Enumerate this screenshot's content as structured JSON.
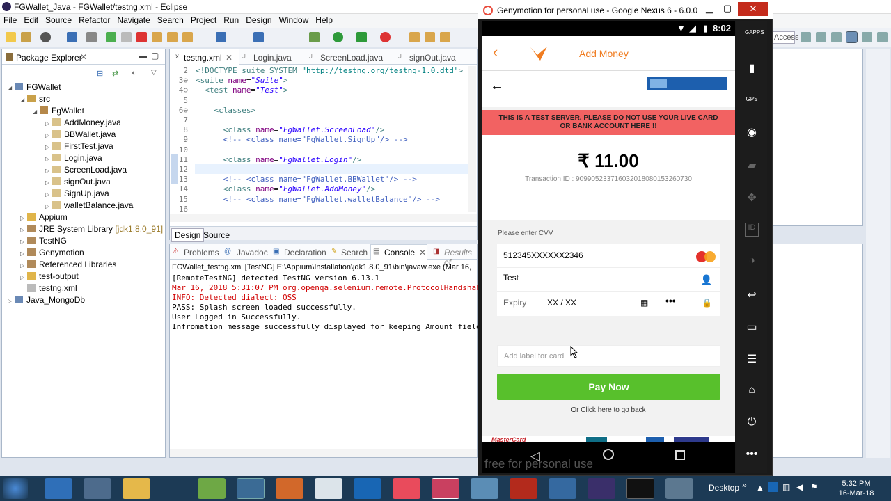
{
  "eclipse": {
    "title": "FGWallet_Java - FGWallet/testng.xml - Eclipse",
    "menu": [
      "File",
      "Edit",
      "Source",
      "Refactor",
      "Navigate",
      "Search",
      "Project",
      "Run",
      "Design",
      "Window",
      "Help"
    ],
    "quick_access": "Access",
    "package_explorer": {
      "tab": "Package Explorer",
      "items": [
        {
          "label": "FGWallet",
          "indent": 0,
          "icon": "project-icon",
          "arrow": "◢"
        },
        {
          "label": "src",
          "indent": 1,
          "icon": "source-folder-icon",
          "arrow": "◢"
        },
        {
          "label": "FgWallet",
          "indent": 2,
          "icon": "package-icon",
          "arrow": "◢"
        },
        {
          "label": "AddMoney.java",
          "indent": 3,
          "icon": "java-file-icon",
          "arrow": "▷"
        },
        {
          "label": "BBWallet.java",
          "indent": 3,
          "icon": "java-file-icon",
          "arrow": "▷"
        },
        {
          "label": "FirstTest.java",
          "indent": 3,
          "icon": "java-file-icon",
          "arrow": "▷"
        },
        {
          "label": "Login.java",
          "indent": 3,
          "icon": "java-file-icon",
          "arrow": "▷"
        },
        {
          "label": "ScreenLoad.java",
          "indent": 3,
          "icon": "java-file-icon",
          "arrow": "▷"
        },
        {
          "label": "signOut.java",
          "indent": 3,
          "icon": "java-file-icon",
          "arrow": "▷"
        },
        {
          "label": "SignUp.java",
          "indent": 3,
          "icon": "java-file-icon",
          "arrow": "▷"
        },
        {
          "label": "walletBalance.java",
          "indent": 3,
          "icon": "java-file-icon",
          "arrow": "▷"
        },
        {
          "label": "Appium",
          "indent": 1,
          "icon": "folder-icon",
          "arrow": "▷"
        },
        {
          "label": "JRE System Library",
          "suffix": "[jdk1.8.0_91]",
          "indent": 1,
          "icon": "library-icon",
          "arrow": "▷"
        },
        {
          "label": "TestNG",
          "indent": 1,
          "icon": "library-icon",
          "arrow": "▷"
        },
        {
          "label": "Genymotion",
          "indent": 1,
          "icon": "library-icon",
          "arrow": "▷"
        },
        {
          "label": "Referenced Libraries",
          "indent": 1,
          "icon": "library-icon",
          "arrow": "▷"
        },
        {
          "label": "test-output",
          "indent": 1,
          "icon": "folder-icon",
          "arrow": "▷"
        },
        {
          "label": "testng.xml",
          "indent": 1,
          "icon": "xml-file-icon",
          "arrow": ""
        },
        {
          "label": "Java_MongoDb",
          "indent": 0,
          "icon": "project-icon",
          "arrow": "▷"
        }
      ]
    },
    "editor": {
      "tabs": [
        "testng.xml",
        "Login.java",
        "ScreenLoad.java",
        "signOut.java"
      ],
      "lines": [
        {
          "n": "2",
          "html": "<span class=\"tag\">&lt;!DOCTYPE suite SYSTEM </span><span class=\"dt\">\"http://testng.org/testng-1.0.dtd\"</span><span class=\"tag\">&gt;</span>"
        },
        {
          "n": "3⊖",
          "html": "<span class=\"tag\">&lt;suite </span><span class=\"attr\">name</span>=<span class=\"str\">\"Suite\"</span><span class=\"tag\">&gt;</span>"
        },
        {
          "n": "4⊖",
          "html": "  <span class=\"tag\">&lt;test </span><span class=\"attr\">name</span>=<span class=\"str\">\"Test\"</span><span class=\"tag\">&gt;</span>"
        },
        {
          "n": "5",
          "html": ""
        },
        {
          "n": "6⊖",
          "html": "    <span class=\"tag\">&lt;classes&gt;</span>"
        },
        {
          "n": "7",
          "html": ""
        },
        {
          "n": "8",
          "html": "      <span class=\"tag\">&lt;class </span><span class=\"attr\">name</span>=<span class=\"str\">\"FgWallet.ScreenLoad\"</span><span class=\"tag\">/&gt;</span>"
        },
        {
          "n": "9",
          "html": "      <span class=\"cmt\">&lt;!-- &lt;class name=\"FgWallet.SignUp\"/&gt; --&gt;</span>"
        },
        {
          "n": "10",
          "html": ""
        },
        {
          "n": "11",
          "html": "      <span class=\"tag\">&lt;class </span><span class=\"attr\">name</span>=<span class=\"str\">\"FgWallet.Login\"</span><span class=\"tag\">/&gt;</span>"
        },
        {
          "n": "12",
          "html": ""
        },
        {
          "n": "13",
          "html": "      <span class=\"cmt\">&lt;!-- &lt;class name=\"FgWallet.BBWallet\"/&gt; --&gt;</span>"
        },
        {
          "n": "14",
          "html": "      <span class=\"tag\">&lt;class </span><span class=\"attr\">name</span>=<span class=\"str\">\"FgWallet.AddMoney\"</span><span class=\"tag\">/&gt;</span>"
        },
        {
          "n": "15",
          "html": "      <span class=\"cmt\">&lt;!-- &lt;class name=\"FgWallet.walletBalance\"/&gt; --&gt;</span>"
        },
        {
          "n": "16",
          "html": ""
        }
      ],
      "bottom_tabs": [
        "Design",
        "Source"
      ]
    },
    "console": {
      "tabs": [
        "Problems",
        "Javadoc",
        "Declaration",
        "Search",
        "Console",
        "Results of"
      ],
      "header": "FGWallet_testng.xml [TestNG] E:\\Appium\\Installation\\jdk1.8.0_91\\bin\\javaw.exe (Mar 16,",
      "lines": [
        {
          "text": "[RemoteTestNG] detected TestNG version 6.13.1",
          "color": "#000"
        },
        {
          "text": "Mar 16, 2018 5:31:07 PM org.openqa.selenium.remote.ProtocolHandshak",
          "color": "#d00000"
        },
        {
          "text": "INFO: Detected dialect: OSS",
          "color": "#d00000"
        },
        {
          "text": "PASS: Splash screen loaded successfully.",
          "color": "#000"
        },
        {
          "text": "User Logged in Successfully.",
          "color": "#000"
        },
        {
          "text": "Infromation message successfully displayed for keeping Amount field",
          "color": "#000"
        }
      ]
    }
  },
  "genymotion": {
    "title": "Genymotion for personal use - Google Nexus 6 - 6.0.0 - ...",
    "clock": "8:02",
    "watermark": "free for personal use",
    "app": {
      "header_title": "Add Money",
      "warning": "THIS IS A TEST SERVER. PLEASE DO NOT USE YOUR LIVE CARD OR BANK ACCOUNT HERE !!",
      "amount": "₹ 11.00",
      "transaction": "Transaction ID : 909905233716032018080153260730",
      "cvv_label": "Please enter CVV",
      "card_number": "512345XXXXXX2346",
      "card_brand": "MasterCard",
      "name": "Test",
      "expiry_label": "Expiry",
      "expiry_value": "XX / XX",
      "cvv_dots": "•••",
      "label_placeholder": "Add label for card",
      "pay_button": "Pay Now",
      "go_back_prefix": "Or ",
      "go_back_link": "Click here to go back",
      "footer_brand": "MasterCard",
      "accent": "#f07d22",
      "pay_color": "#58c02c",
      "warning_color": "#f26262"
    },
    "sidebar_icons": [
      "GAPPS",
      "battery",
      "GPS",
      "webcam",
      "camera",
      "dpad",
      "ID",
      "media",
      "back",
      "recent",
      "menu",
      "home",
      "power",
      "more"
    ]
  },
  "taskbar": {
    "desktop_label": "Desktop",
    "time": "5:32 PM",
    "date": "16-Mar-18"
  }
}
